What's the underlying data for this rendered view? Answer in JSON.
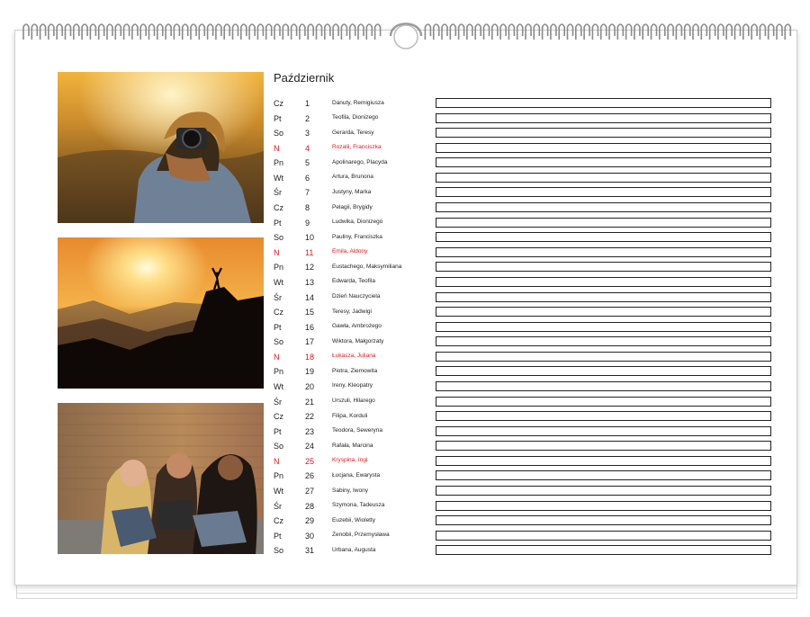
{
  "calendar": {
    "month": "Październik",
    "accent_color": "#e3161c",
    "photos": [
      {
        "name": "photographer-photo"
      },
      {
        "name": "mountain-sunset-photo"
      },
      {
        "name": "friends-laughing-photo"
      }
    ],
    "days": [
      {
        "dow": "Cz",
        "day": "1",
        "names": "Danuty, Remigiusza",
        "sunday": false
      },
      {
        "dow": "Pt",
        "day": "2",
        "names": "Teofila, Dionizego",
        "sunday": false
      },
      {
        "dow": "So",
        "day": "3",
        "names": "Gerarda, Teresy",
        "sunday": false
      },
      {
        "dow": "N",
        "day": "4",
        "names": "Rozalii, Franciszka",
        "sunday": true
      },
      {
        "dow": "Pn",
        "day": "5",
        "names": "Apolinarego, Placyda",
        "sunday": false
      },
      {
        "dow": "Wt",
        "day": "6",
        "names": "Artura, Brunona",
        "sunday": false
      },
      {
        "dow": "Śr",
        "day": "7",
        "names": "Justyny, Marka",
        "sunday": false
      },
      {
        "dow": "Cz",
        "day": "8",
        "names": "Pelagii, Brygidy",
        "sunday": false
      },
      {
        "dow": "Pt",
        "day": "9",
        "names": "Ludwika, Dionizego",
        "sunday": false
      },
      {
        "dow": "So",
        "day": "10",
        "names": "Pauliny, Franciszka",
        "sunday": false
      },
      {
        "dow": "N",
        "day": "11",
        "names": "Emila, Aldony",
        "sunday": true
      },
      {
        "dow": "Pn",
        "day": "12",
        "names": "Eustachego, Maksymiliana",
        "sunday": false
      },
      {
        "dow": "Wt",
        "day": "13",
        "names": "Edwarda, Teofila",
        "sunday": false
      },
      {
        "dow": "Śr",
        "day": "14",
        "names": "Dzień Nauczyciela",
        "sunday": false
      },
      {
        "dow": "Cz",
        "day": "15",
        "names": "Teresy, Jadwigi",
        "sunday": false
      },
      {
        "dow": "Pt",
        "day": "16",
        "names": "Gawła, Ambrożego",
        "sunday": false
      },
      {
        "dow": "So",
        "day": "17",
        "names": "Wiktora, Małgorzaty",
        "sunday": false
      },
      {
        "dow": "N",
        "day": "18",
        "names": "Łukasza, Juliana",
        "sunday": true
      },
      {
        "dow": "Pn",
        "day": "19",
        "names": "Piotra, Ziemowita",
        "sunday": false
      },
      {
        "dow": "Wt",
        "day": "20",
        "names": "Ireny, Kleopatry",
        "sunday": false
      },
      {
        "dow": "Śr",
        "day": "21",
        "names": "Urszuli, Hilarego",
        "sunday": false
      },
      {
        "dow": "Cz",
        "day": "22",
        "names": "Filipa, Korduli",
        "sunday": false
      },
      {
        "dow": "Pt",
        "day": "23",
        "names": "Teodora, Seweryna",
        "sunday": false
      },
      {
        "dow": "So",
        "day": "24",
        "names": "Rafała, Marcina",
        "sunday": false
      },
      {
        "dow": "N",
        "day": "25",
        "names": "Kryspina, Ingi",
        "sunday": true
      },
      {
        "dow": "Pn",
        "day": "26",
        "names": "Łucjana, Ewarysta",
        "sunday": false
      },
      {
        "dow": "Wt",
        "day": "27",
        "names": "Sabiny, Iwony",
        "sunday": false
      },
      {
        "dow": "Śr",
        "day": "28",
        "names": "Szymona, Tadeusza",
        "sunday": false
      },
      {
        "dow": "Cz",
        "day": "29",
        "names": "Euzebii, Wioletty",
        "sunday": false
      },
      {
        "dow": "Pt",
        "day": "30",
        "names": "Zenobii, Przemysława",
        "sunday": false
      },
      {
        "dow": "So",
        "day": "31",
        "names": "Urbana, Augusta",
        "sunday": false
      }
    ]
  }
}
